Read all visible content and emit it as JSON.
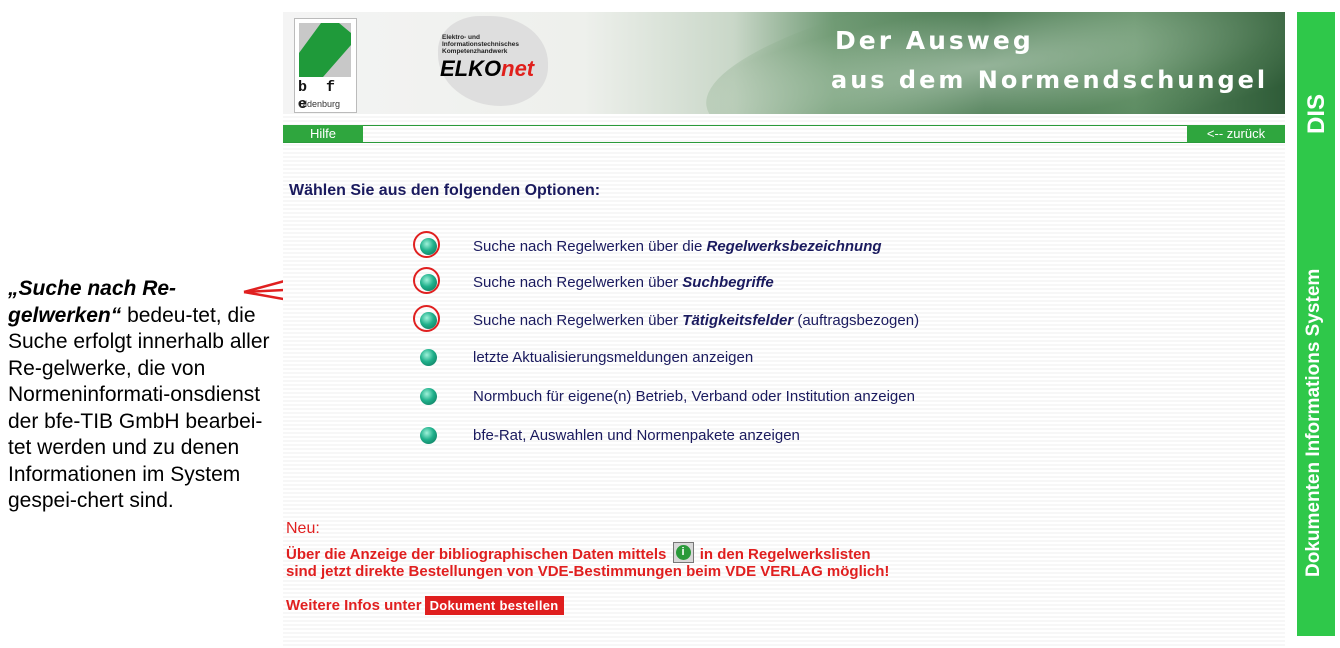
{
  "annotation": {
    "emphasis": "„Suche nach Re-gelwerken“",
    "body": "bedeu-tet, die Suche erfolgt innerhalb aller Re-gelwerke, die von Normeninformati-onsdienst der bfe-TIB GmbH bearbei-tet werden und zu denen Informationen im System gespei-chert sind."
  },
  "banner": {
    "bfe_logo_text": "b f e",
    "bfe_logo_city": "Oldenburg",
    "elko_small": "Elektro- und Informationstechnisches Kompetenzhandwerk",
    "elko_name": "ELKO",
    "elko_net": "net",
    "slogan_line1": "Der Ausweg",
    "slogan_line2": "aus dem Normendschungel"
  },
  "nav": {
    "help": "Hilfe",
    "back": "<-- zurück"
  },
  "main": {
    "heading": "Wählen Sie aus den folgenden Optionen:",
    "options": [
      {
        "prefix": "Suche nach Regelwerken über die ",
        "bold": "Regelwerksbezeichnung",
        "suffix": ""
      },
      {
        "prefix": "Suche nach Regelwerken über ",
        "bold": "Suchbegriffe",
        "suffix": ""
      },
      {
        "prefix": "Suche nach Regelwerken über ",
        "bold": "Tätigkeitsfelder",
        "suffix": " (auftragsbezogen)"
      },
      {
        "prefix": "letzte Aktualisierungsmeldungen anzeigen",
        "bold": "",
        "suffix": ""
      },
      {
        "prefix": "Normbuch für eigene(n) Betrieb, Verband oder Institution anzeigen",
        "bold": "",
        "suffix": ""
      },
      {
        "prefix": "bfe-Rat, Auswahlen und Normenpakete anzeigen",
        "bold": "",
        "suffix": ""
      }
    ],
    "news_label": "Neu:",
    "news_line1_a": "Über die Anzeige der bibliographischen Daten mittels",
    "news_line1_b": "in den Regelwerkslisten",
    "news_line2": "sind jetzt direkte Bestellungen von VDE-Bestimmungen beim VDE VERLAG möglich!",
    "more_label": "Weitere Infos unter",
    "order_button": "Dokument bestellen"
  },
  "sidebar": {
    "abbr": "DIS",
    "full": "Dokumenten Informations System"
  },
  "colors": {
    "accent_green": "#2fc84a",
    "nav_green": "#2fa63e",
    "alert_red": "#e01f1f",
    "text_navy": "#1a1a5e"
  },
  "icons": {
    "bullet": "teal-ball-icon",
    "info": "info-icon"
  }
}
